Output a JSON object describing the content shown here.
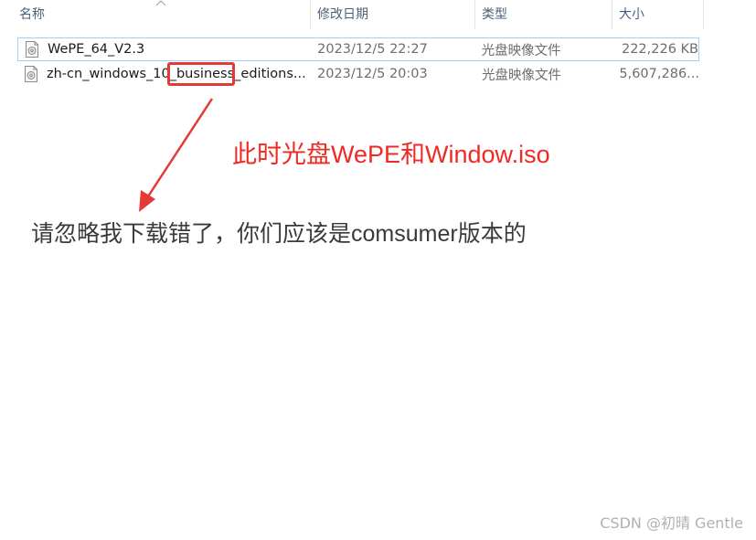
{
  "columns": {
    "name": "名称",
    "date_modified": "修改日期",
    "type": "类型",
    "size": "大小"
  },
  "files": [
    {
      "name": "WePE_64_V2.3",
      "date": "2023/12/5 22:27",
      "type": "光盘映像文件",
      "size": "222,226 KB",
      "icon": "disc-image-file-icon"
    },
    {
      "name": "zh-cn_windows_10_business_editions...",
      "date": "2023/12/5 20:03",
      "type": "光盘映像文件",
      "size": "5,607,286...",
      "icon": "disc-image-file-icon"
    }
  ],
  "annotations": {
    "red_note": "此时光盘WePE和Window.iso",
    "gray_note": "请忽略我下载错了，你们应该是comsumer版本的",
    "highlight_color": "#e53935"
  },
  "watermark": "CSDN @初晴 Gentle"
}
